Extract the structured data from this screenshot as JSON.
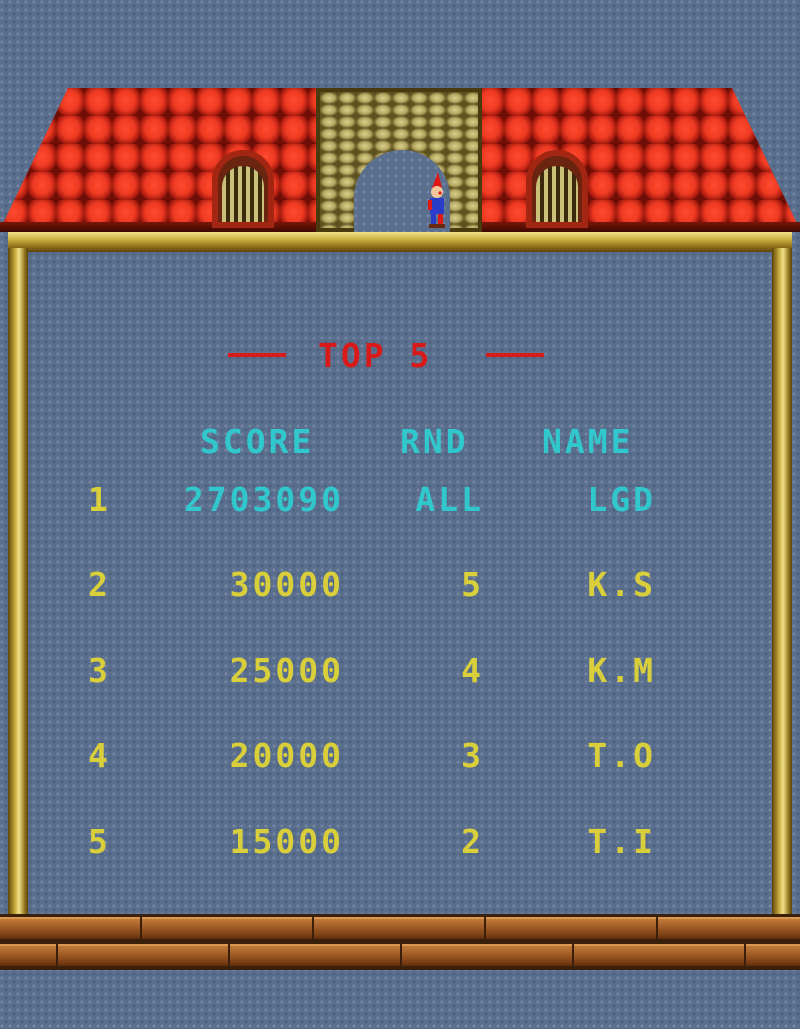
{
  "scoreboard": {
    "title": "TOP 5",
    "headers": {
      "score": "SCORE",
      "round": "RND",
      "name": "NAME"
    },
    "entries": [
      {
        "rank": "1",
        "score": "2703090",
        "round": "ALL",
        "name": "LGD"
      },
      {
        "rank": "2",
        "score": "30000",
        "round": "5",
        "name": "K.S"
      },
      {
        "rank": "3",
        "score": "25000",
        "round": "4",
        "name": "K.M"
      },
      {
        "rank": "4",
        "score": "20000",
        "round": "3",
        "name": "T.O"
      },
      {
        "rank": "5",
        "score": "15000",
        "round": "2",
        "name": "T.I"
      }
    ]
  },
  "colors": {
    "background": "#5a6f8e",
    "title": "#d81a18",
    "header": "#30c8cc",
    "top_entry": "#30c8cc",
    "entries": "#d8cf3a",
    "frame": "#c7aa3c",
    "roof": "#e0301c"
  },
  "scene": {
    "roof_windows": [
      "left-shutter",
      "right-shutter"
    ],
    "gate": "stone-arch",
    "character": "clown-icon"
  }
}
